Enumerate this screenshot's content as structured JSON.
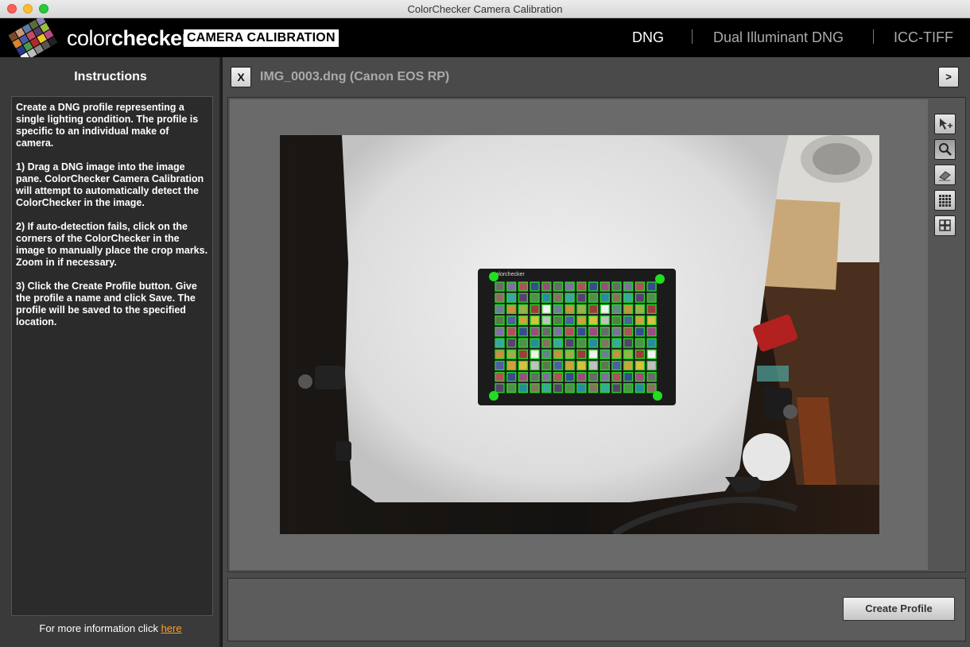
{
  "window": {
    "title": "ColorChecker Camera Calibration"
  },
  "header": {
    "logo_word_light": "color",
    "logo_word_bold": "checker",
    "logo_badge": "CAMERA CALIBRATION",
    "tabs": [
      {
        "label": "DNG",
        "active": true
      },
      {
        "label": "Dual Illuminant DNG",
        "active": false
      },
      {
        "label": "ICC-TIFF",
        "active": false
      }
    ]
  },
  "sidebar": {
    "title": "Instructions",
    "paragraphs": [
      "Create a DNG profile representing a single lighting condition. The profile is specific to an individual make of camera.",
      "1) Drag a DNG image into the image pane. ColorChecker Camera Calibration will attempt to automatically detect the ColorChecker in the image.",
      "2) If auto-detection fails, click on the corners of the ColorChecker in the image to manually place the crop marks. Zoom in if necessary.",
      "3) Click the Create Profile button. Give the profile a name and click Save. The profile will be saved to the specified location."
    ],
    "footer_text": "For more information click ",
    "footer_link": "here"
  },
  "main": {
    "close_label": "X",
    "file_title": "IMG_0003.dng (Canon EOS RP)",
    "next_label": ">",
    "chart_brand": "colorchecker",
    "tools": [
      {
        "icon": "pointer-plus-icon",
        "active": false
      },
      {
        "icon": "magnifier-icon",
        "active": true
      },
      {
        "icon": "eraser-icon",
        "active": false
      },
      {
        "icon": "grid-fine-icon",
        "active": false
      },
      {
        "icon": "grid-coarse-icon",
        "active": false
      }
    ],
    "create_profile_label": "Create Profile"
  },
  "colors": {
    "accent_link": "#ff9f1a",
    "detect_marker": "#22dd22"
  }
}
